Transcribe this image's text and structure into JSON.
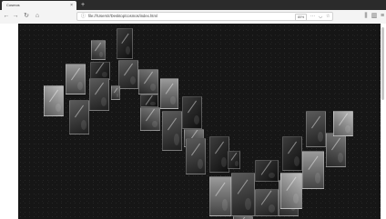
{
  "browser": {
    "tab_title": "Cosmos",
    "tab_close": "×",
    "new_tab": "+",
    "url": "file:///Users/r/Desktop/cosmos/index.html",
    "zoom": "80%"
  },
  "icons": {
    "back": "back-arrow-icon",
    "forward": "forward-arrow-icon",
    "reload": "reload-icon",
    "home": "home-icon",
    "page_info": "info-icon",
    "menu_dots": "more-icon",
    "pocket": "pocket-icon",
    "bookmark": "star-icon",
    "library": "library-icon",
    "sidebar": "sidebar-icon",
    "hamburger": "menu-icon"
  },
  "colors": {
    "canvas_bg": "#161616",
    "chrome_bg": "#f4f4f4",
    "tabstrip_bg": "#2b2b2b"
  },
  "gallery": {
    "photo_count": 40
  }
}
